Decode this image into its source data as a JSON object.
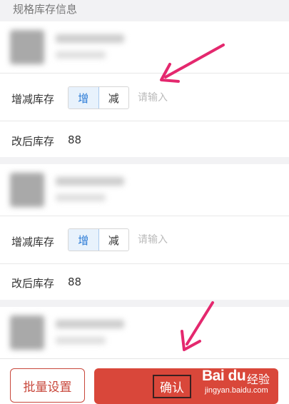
{
  "section_title": "规格库存信息",
  "items": [
    {
      "adjust_label": "增减库存",
      "increase_label": "增",
      "decrease_label": "减",
      "selected": "增",
      "input_placeholder": "请输入",
      "after_label": "改后库存",
      "after_value": "88"
    },
    {
      "adjust_label": "增减库存",
      "increase_label": "增",
      "decrease_label": "减",
      "selected": "增",
      "input_placeholder": "请输入",
      "after_label": "改后库存",
      "after_value": "88"
    }
  ],
  "bottom_bar": {
    "batch_label": "批量设置",
    "confirm_label": "确认"
  },
  "watermark": {
    "logo": "Bai du",
    "text": "经验",
    "url": "jingyan.baidu.com"
  },
  "colors": {
    "accent_red": "#d9473a",
    "annotation_pink": "#e4286e",
    "selected_blue": "#2b7bd6"
  }
}
